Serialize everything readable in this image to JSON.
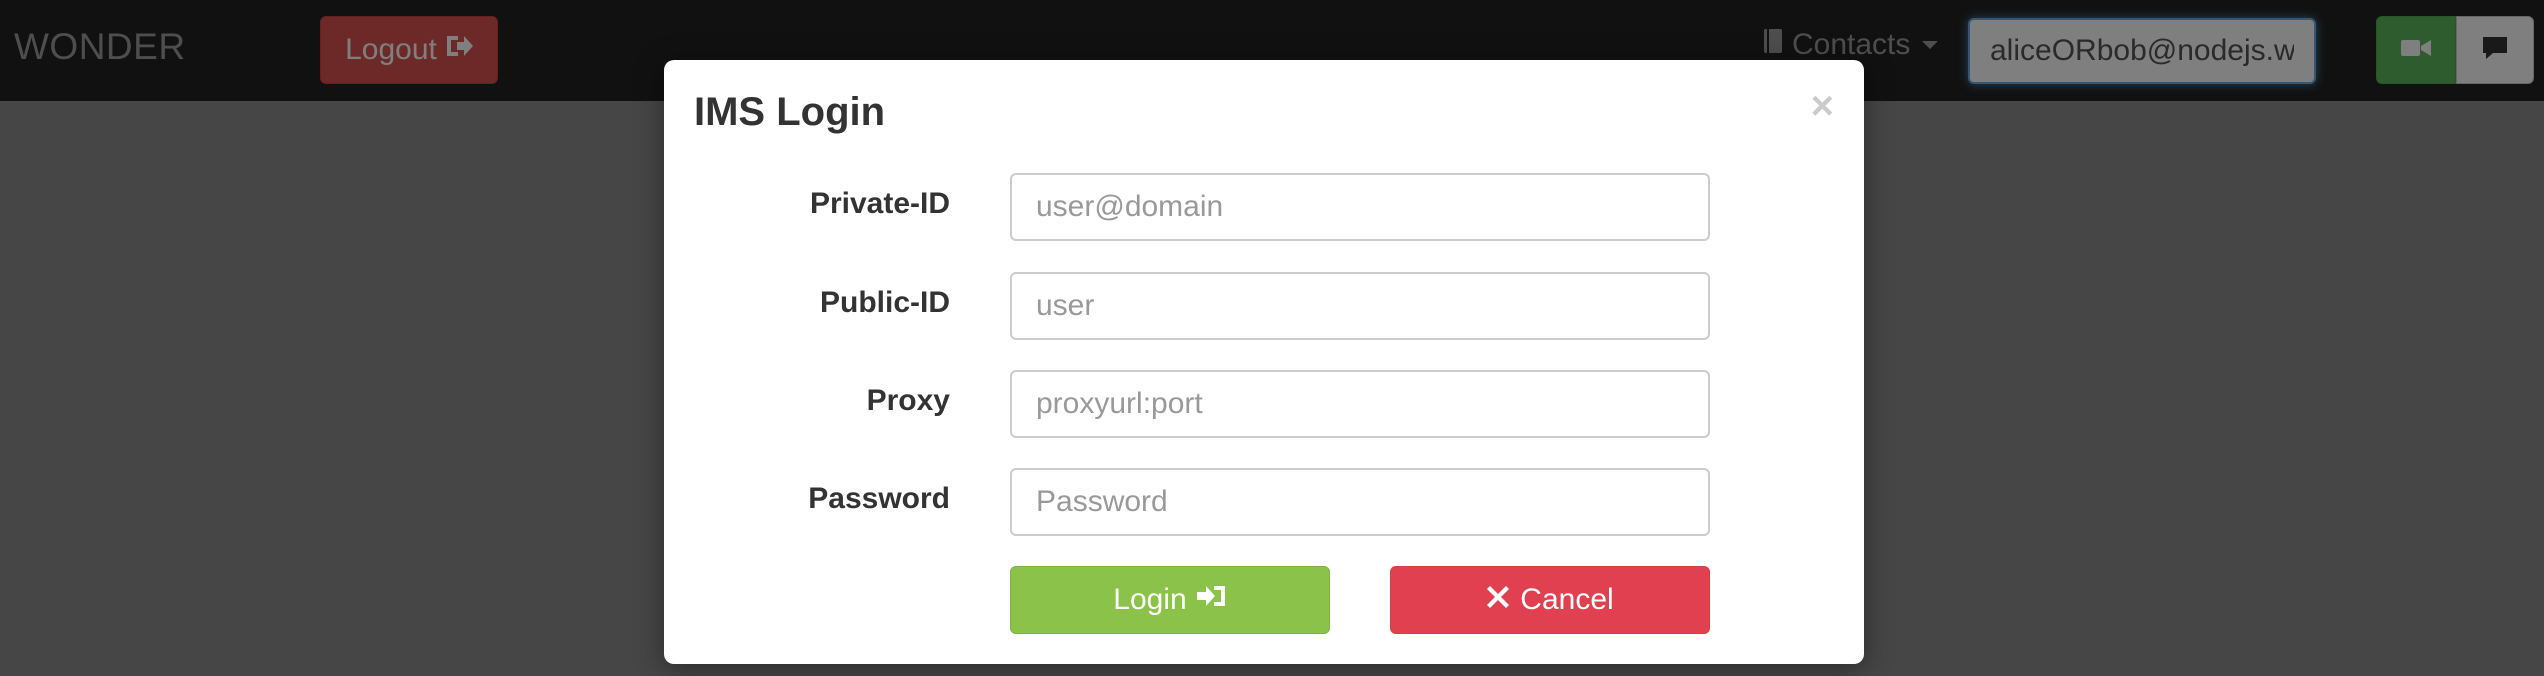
{
  "navbar": {
    "brand": "WONDER",
    "logout_label": "Logout",
    "logout_icon": "logout-icon",
    "contacts_label": "Contacts",
    "contacts_icon": "book-icon",
    "address_value": "aliceORbob@nodejs.wonder",
    "video_icon": "video-camera-icon",
    "chat_icon": "comment-icon"
  },
  "modal": {
    "title": "IMS Login",
    "close_glyph": "×",
    "fields": [
      {
        "label": "Private-ID",
        "placeholder": "user@domain",
        "value": ""
      },
      {
        "label": "Public-ID",
        "placeholder": "user",
        "value": ""
      },
      {
        "label": "Proxy",
        "placeholder": "proxyurl:port",
        "value": ""
      },
      {
        "label": "Password",
        "placeholder": "Password",
        "value": ""
      }
    ],
    "login_label": "Login",
    "login_icon": "login-icon",
    "cancel_label": "Cancel",
    "cancel_icon": "close-icon"
  },
  "colors": {
    "navbar_bg": "#222222",
    "logout_bg": "#d9534f",
    "login_bg": "#8bc34a",
    "cancel_bg": "#e04050",
    "video_bg": "#5cb85c"
  }
}
